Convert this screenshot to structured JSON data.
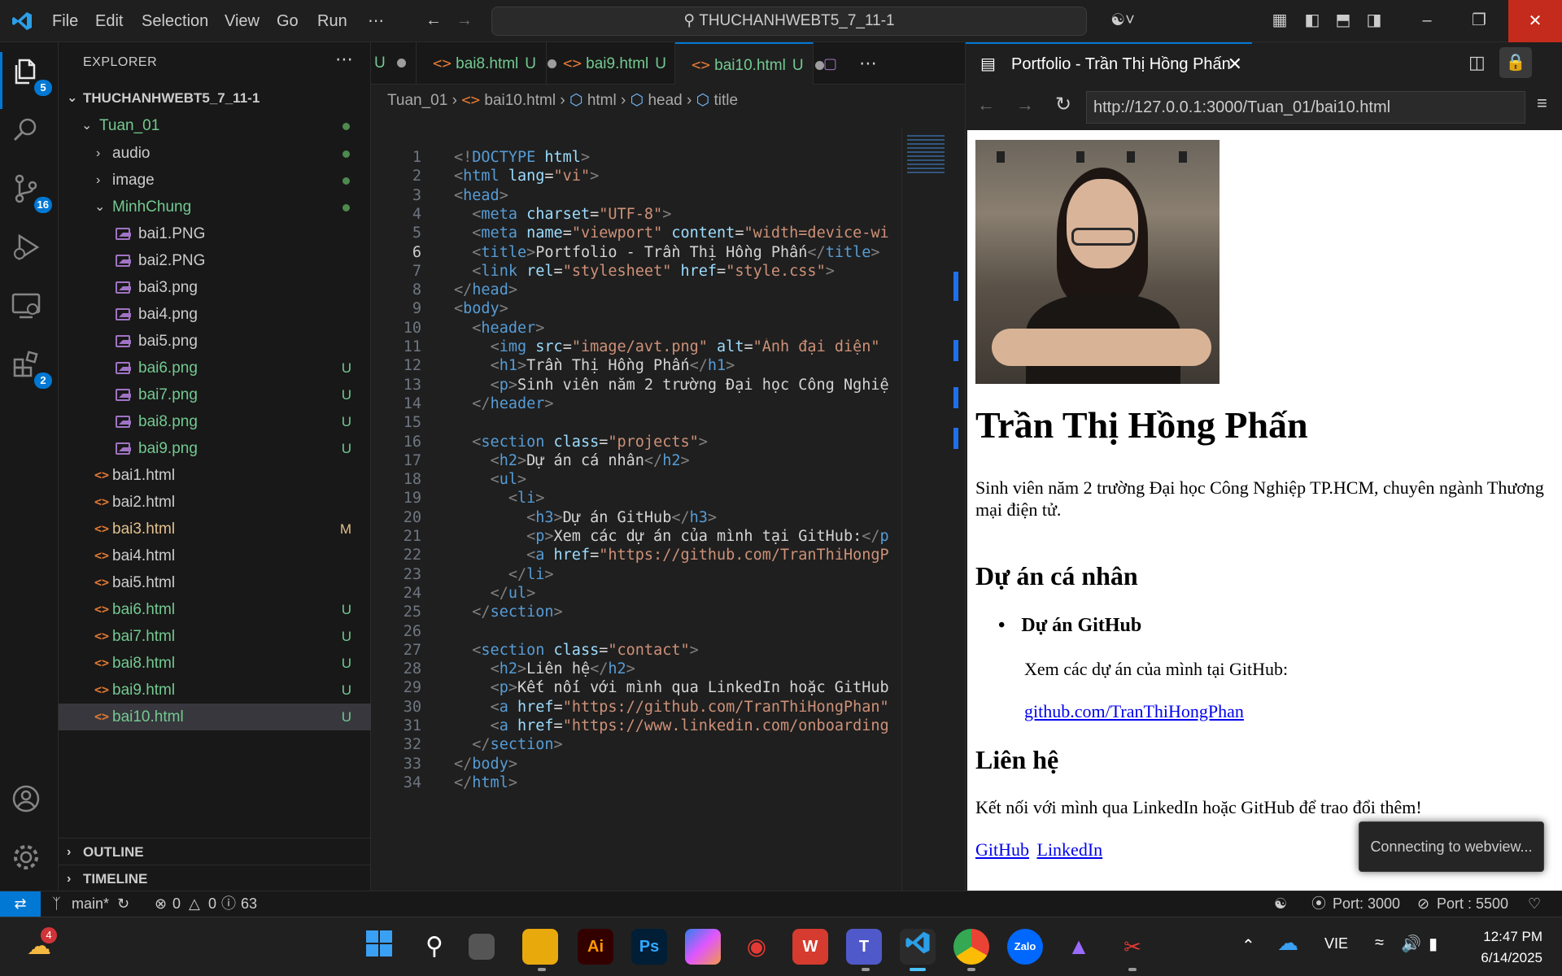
{
  "titlebar": {
    "menu": [
      "File",
      "Edit",
      "Selection",
      "View",
      "Go",
      "Run",
      "⋯"
    ],
    "search_text": "THUCHANHWEBT5_7_11-1",
    "window_buttons": [
      "–",
      "❐",
      "✕"
    ]
  },
  "activity": {
    "explorer_badge": "5",
    "scm_badge": "16",
    "extensions_badge": "2"
  },
  "explorer": {
    "title": "EXPLORER",
    "more": "⋯",
    "root": "THUCHANHWEBT5_7_11-1",
    "folder": "Tuan_01",
    "rows": [
      {
        "name": "audio",
        "kind": "folder-collapsed",
        "status": "dot"
      },
      {
        "name": "image",
        "kind": "folder-collapsed",
        "status": "dot"
      },
      {
        "name": "MinhChung",
        "kind": "folder-open",
        "status": "dot"
      },
      {
        "name": "bai1.PNG",
        "kind": "image",
        "status": ""
      },
      {
        "name": "bai2.PNG",
        "kind": "image",
        "status": ""
      },
      {
        "name": "bai3.png",
        "kind": "image",
        "status": ""
      },
      {
        "name": "bai4.png",
        "kind": "image",
        "status": ""
      },
      {
        "name": "bai5.png",
        "kind": "image",
        "status": ""
      },
      {
        "name": "bai6.png",
        "kind": "image",
        "status": "U"
      },
      {
        "name": "bai7.png",
        "kind": "image",
        "status": "U"
      },
      {
        "name": "bai8.png",
        "kind": "image",
        "status": "U"
      },
      {
        "name": "bai9.png",
        "kind": "image",
        "status": "U"
      },
      {
        "name": "bai1.html",
        "kind": "html",
        "status": ""
      },
      {
        "name": "bai2.html",
        "kind": "html",
        "status": ""
      },
      {
        "name": "bai3.html",
        "kind": "html",
        "status": "M"
      },
      {
        "name": "bai4.html",
        "kind": "html",
        "status": ""
      },
      {
        "name": "bai5.html",
        "kind": "html",
        "status": ""
      },
      {
        "name": "bai6.html",
        "kind": "html",
        "status": "U"
      },
      {
        "name": "bai7.html",
        "kind": "html",
        "status": "U"
      },
      {
        "name": "bai8.html",
        "kind": "html",
        "status": "U"
      },
      {
        "name": "bai9.html",
        "kind": "html",
        "status": "U"
      },
      {
        "name": "bai10.html",
        "kind": "html",
        "status": "U"
      }
    ],
    "outline": "OUTLINE",
    "timeline": "TIMELINE"
  },
  "editor": {
    "tabs": [
      {
        "name": "",
        "status": "U"
      },
      {
        "name": "bai8.html",
        "status": "U"
      },
      {
        "name": "bai9.html",
        "status": "U"
      },
      {
        "name": "bai10.html",
        "status": "U"
      }
    ],
    "breadcrumb": [
      "Tuan_01",
      "bai10.html",
      "html",
      "head",
      "title"
    ],
    "current_line": 6,
    "lines": [
      "<!DOCTYPE html>",
      "<html lang=\"vi\">",
      "<head>",
      "  <meta charset=\"UTF-8\">",
      "  <meta name=\"viewport\" content=\"width=device-wi",
      "  <title>Portfolio - Trần Thị Hồng Phấn</title>",
      "  <link rel=\"stylesheet\" href=\"style.css\">",
      "</head>",
      "<body>",
      "  <header>",
      "    <img src=\"image/avt.png\" alt=\"Ảnh đại diện\"",
      "    <h1>Trần Thị Hồng Phấn</h1>",
      "    <p>Sinh viên năm 2 trường Đại học Công Nghiệ",
      "  </header>",
      "",
      "  <section class=\"projects\">",
      "    <h2>Dự án cá nhân</h2>",
      "    <ul>",
      "      <li>",
      "        <h3>Dự án GitHub</h3>",
      "        <p>Xem các dự án của mình tại GitHub:</p",
      "        <a href=\"https://github.com/TranThiHongP",
      "      </li>",
      "    </ul>",
      "  </section>",
      "",
      "  <section class=\"contact\">",
      "    <h2>Liên hệ</h2>",
      "    <p>Kết nối với mình qua LinkedIn hoặc GitHub",
      "    <a href=\"https://github.com/TranThiHongPhan\"",
      "    <a href=\"https://www.linkedin.com/onboarding",
      "  </section>",
      "</body>",
      "</html>"
    ]
  },
  "preview": {
    "tab_title": "Portfolio - Trần Thị Hồng Phấn",
    "url": "http://127.0.0.1:3000/Tuan_01/bai10.html",
    "page": {
      "h1": "Trần Thị Hồng Phấn",
      "intro": "Sinh viên năm 2 trường Đại học Công Nghiệp TP.HCM, chuyên ngành Thương mại điện tử.",
      "projects_heading": "Dự án cá nhân",
      "project_title": "Dự án GitHub",
      "project_desc": "Xem các dự án của mình tại GitHub:",
      "project_link": "github.com/TranThiHongPhan",
      "contact_heading": "Liên hệ",
      "contact_text": "Kết nối với mình qua LinkedIn hoặc GitHub để trao đổi thêm!",
      "link_github": "GitHub",
      "link_linkedin": "LinkedIn"
    },
    "toast": "Connecting to webview..."
  },
  "statusbar": {
    "branch": "main*",
    "errors": "0",
    "warnings": "0",
    "info": "63",
    "port_live": "Port: 3000",
    "port_server": "Port : 5500"
  },
  "taskbar": {
    "weather_badge": "4",
    "language": "VIE",
    "time": "12:47 PM",
    "date": "6/14/2025"
  },
  "colors": {
    "accent": "#0078d4",
    "untracked": "#73c991",
    "modified": "#e2c08d",
    "link": "#0000ee"
  }
}
